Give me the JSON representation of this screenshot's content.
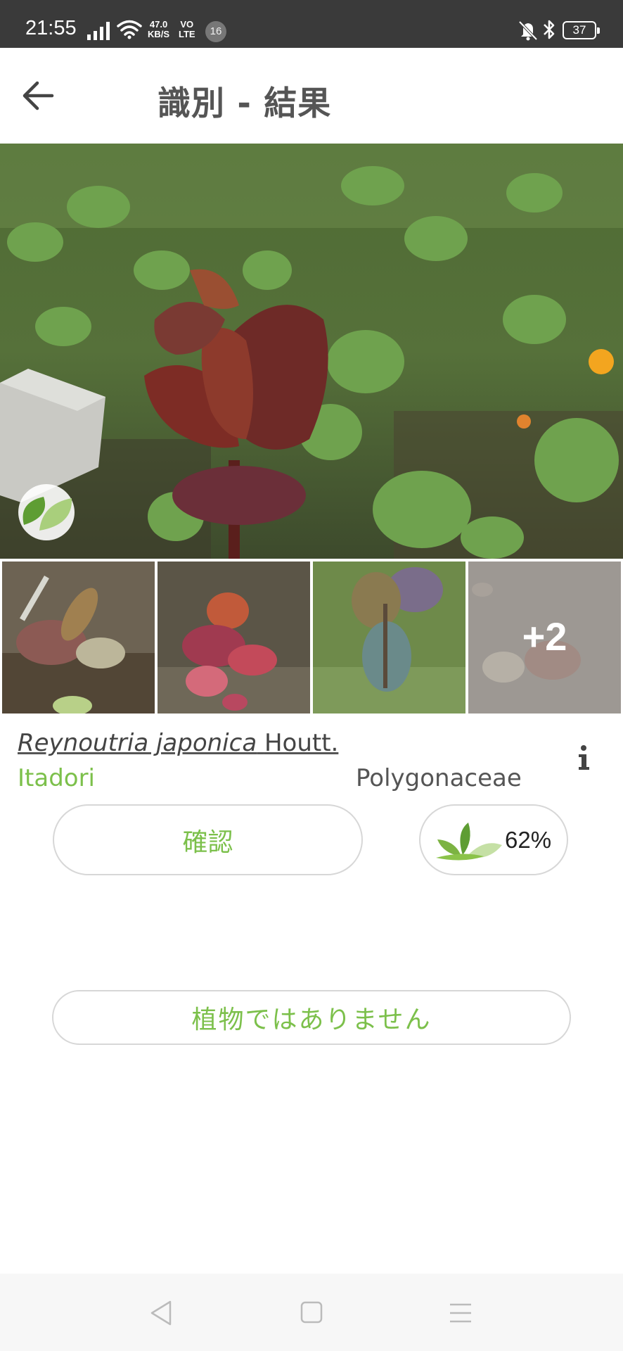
{
  "status_bar": {
    "time": "21:55",
    "net_speed_value": "47.0",
    "net_speed_unit": "KB/S",
    "volte_top": "VO",
    "volte_bottom": "LTE",
    "notification_count": "16",
    "battery": "37"
  },
  "header": {
    "title": "識別 - 結果",
    "back_icon": "arrow-left-icon"
  },
  "thumbnails": {
    "count_visible": 4,
    "more_label": "+2"
  },
  "result": {
    "scientific_name": "Reynoutria japonica",
    "author": "Houtt.",
    "common_name": "Itadori",
    "family": "Polygonaceae",
    "confirm_label": "確認",
    "score": "62%",
    "info_icon": "info-icon"
  },
  "not_plant_label": "植物ではありません",
  "colors": {
    "accent_green": "#7cc04b",
    "status_bar_bg": "#3a3a3a",
    "text_gray": "#555555"
  },
  "nav": {
    "icons": [
      "nav-back-icon",
      "nav-home-icon",
      "nav-menu-icon"
    ]
  }
}
